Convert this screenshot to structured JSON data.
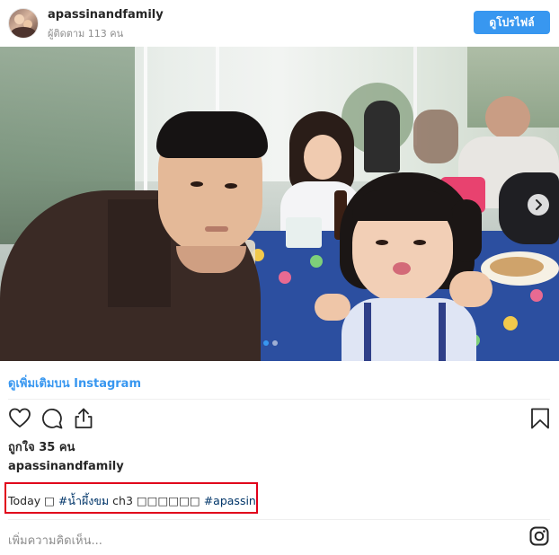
{
  "header": {
    "username": "apassinandfamily",
    "followers": "ผู้ติดตาม 113 คน",
    "profile_button": "ดูโปรไฟล์"
  },
  "post": {
    "see_more": "ดูเพิ่มเติมบน Instagram",
    "likes": "ถูกใจ 35 คน",
    "caption_user": "apassinandfamily",
    "caption": {
      "prefix": "Today □ ",
      "hashtag1": "#น้ำผึ้งขม",
      "middle": " ch3 □□□□□□ ",
      "hashtag2": "#apassin"
    },
    "comment_placeholder": "เพิ่มความคิดเห็น..."
  },
  "carousel": {
    "slides": 2,
    "active": 1
  },
  "icons": {
    "heart": "heart-icon",
    "comment": "comment-icon",
    "share": "share-icon",
    "bookmark": "bookmark-icon",
    "instagram": "instagram-icon",
    "next": "chevron-right-icon"
  },
  "colors": {
    "accent": "#3897f0",
    "highlight_border": "#e1001b",
    "hashtag": "#003569",
    "muted": "#8e8e8e"
  }
}
